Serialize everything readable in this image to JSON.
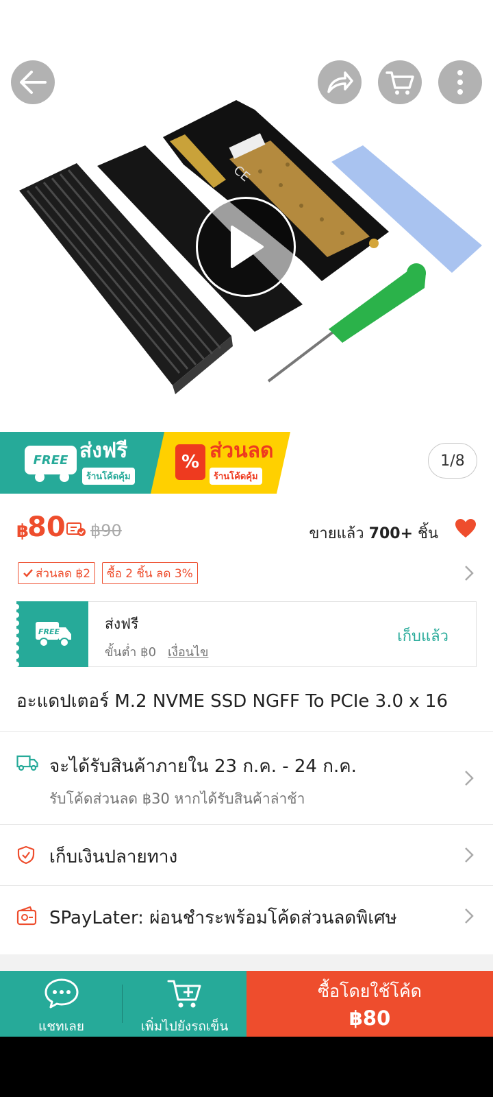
{
  "gallery": {
    "counter": "1/8"
  },
  "banner": {
    "free_badge": "FREE",
    "free_title": "ส่งฟรี",
    "free_sub": "ร้านโค้ดคุ้ม",
    "discount_symbol": "%",
    "discount_title": "ส่วนลด",
    "discount_sub": "ร้านโค้ดคุ้ม"
  },
  "price": {
    "currency": "฿",
    "current": "80",
    "original": "฿90",
    "sold_prefix": "ขายแล้ว",
    "sold_count": "700+",
    "sold_suffix": "ชิ้น"
  },
  "tags": [
    {
      "label": "ส่วนลด ฿2"
    },
    {
      "label": "ซื้อ 2 ชิ้น ลด 3%"
    }
  ],
  "voucher": {
    "badge": "FREE",
    "title": "ส่งฟรี",
    "min_spend": "ขั้นต่ำ ฿0",
    "conditions": "เงื่อนไข",
    "status": "เก็บแล้ว"
  },
  "product": {
    "title": "อะแดปเตอร์ M.2 NVME SSD NGFF To PCIe 3.0 x 16"
  },
  "info_rows": {
    "delivery_main": "จะได้รับสินค้าภายใน 23 ก.ค. - 24 ก.ค.",
    "delivery_sub": "รับโค้ดส่วนลด ฿30 หากได้รับสินค้าล่าช้า",
    "cod": "เก็บเงินปลายทาง",
    "paylater": "SPayLater: ผ่อนชำระพร้อมโค้ดส่วนลดพิเศษ"
  },
  "bottom_bar": {
    "chat_label": "แชทเลย",
    "cart_label": "เพิ่มไปยังรถเข็น",
    "buy_label": "ซื้อโดยใช้โค้ด",
    "buy_price": "฿80"
  },
  "colors": {
    "brand": "#ee4d2d",
    "teal": "#26aa99",
    "yellow": "#ffd000"
  }
}
